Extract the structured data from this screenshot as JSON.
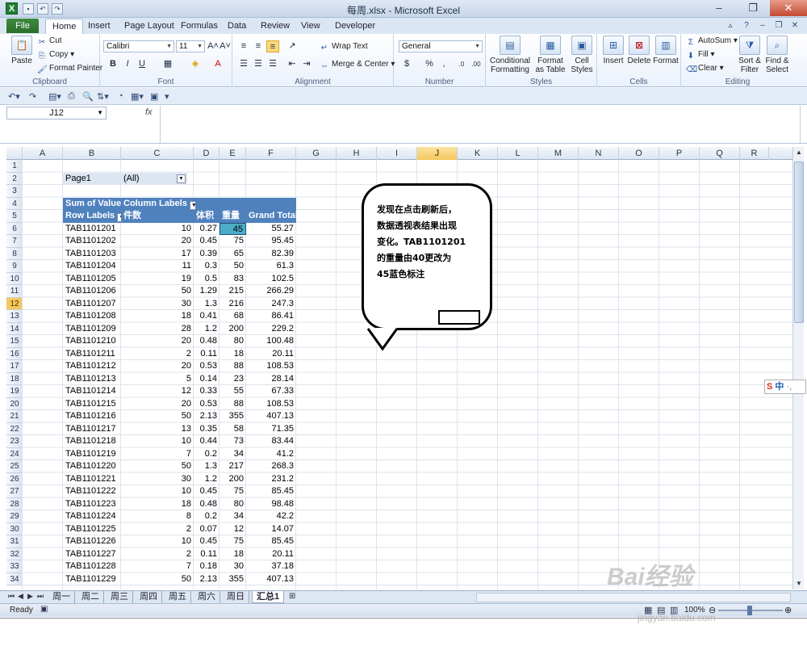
{
  "window": {
    "title": "每周.xlsx - Microsoft Excel",
    "logo_letter": "X"
  },
  "tabs": {
    "file": "File",
    "items": [
      "Home",
      "Insert",
      "Page Layout",
      "Formulas",
      "Data",
      "Review",
      "View",
      "Developer"
    ],
    "active": "Home"
  },
  "ribbon": {
    "clipboard": {
      "paste": "Paste",
      "cut": "Cut",
      "copy": "Copy",
      "format_painter": "Format Painter",
      "label": "Clipboard"
    },
    "font": {
      "name": "Calibri",
      "size": "11",
      "bold": "B",
      "italic": "I",
      "underline": "U",
      "label": "Font"
    },
    "alignment": {
      "wrap_text": "Wrap Text",
      "merge_center": "Merge & Center",
      "label": "Alignment"
    },
    "number": {
      "format": "General",
      "currency": "$",
      "percent": "%",
      "comma": ",",
      "label": "Number"
    },
    "styles": {
      "conditional": "Conditional Formatting",
      "format_table": "Format as Table",
      "cell_styles": "Cell Styles",
      "label": "Styles"
    },
    "cells": {
      "insert": "Insert",
      "delete": "Delete",
      "format": "Format",
      "label": "Cells"
    },
    "editing": {
      "autosum": "AutoSum",
      "fill": "Fill",
      "clear": "Clear",
      "sort_filter": "Sort & Filter",
      "find_select": "Find & Select",
      "label": "Editing"
    }
  },
  "formula_bar": {
    "name_box": "J12",
    "fx": "fx",
    "value": ""
  },
  "grid": {
    "columns": [
      "A",
      "B",
      "C",
      "D",
      "E",
      "F",
      "G",
      "H",
      "I",
      "J",
      "K",
      "L",
      "M",
      "N",
      "O",
      "P",
      "Q",
      "R"
    ],
    "selected_column": "J",
    "rows": [
      "1",
      "2",
      "3",
      "4",
      "5",
      "6",
      "7",
      "8",
      "9",
      "10",
      "11",
      "12",
      "13",
      "14",
      "15",
      "16",
      "17",
      "18",
      "19",
      "20",
      "21",
      "22",
      "23",
      "24",
      "25",
      "26",
      "27",
      "28",
      "29",
      "30",
      "31",
      "32",
      "33",
      "34"
    ],
    "selected_row": "12"
  },
  "pivot": {
    "page_field": "Page1",
    "page_value": "(All)",
    "sum_of_value": "Sum of Value",
    "column_labels": "Column Labels",
    "row_labels": "Row Labels",
    "col_headers": [
      "件数",
      "体积",
      "重量",
      "Grand Total"
    ],
    "rows": [
      {
        "label": "TAB1101201",
        "count": "10",
        "volume": "0.27",
        "weight": "45",
        "total": "55.27"
      },
      {
        "label": "TAB1101202",
        "count": "20",
        "volume": "0.45",
        "weight": "75",
        "total": "95.45"
      },
      {
        "label": "TAB1101203",
        "count": "17",
        "volume": "0.39",
        "weight": "65",
        "total": "82.39"
      },
      {
        "label": "TAB1101204",
        "count": "11",
        "volume": "0.3",
        "weight": "50",
        "total": "61.3"
      },
      {
        "label": "TAB1101205",
        "count": "19",
        "volume": "0.5",
        "weight": "83",
        "total": "102.5"
      },
      {
        "label": "TAB1101206",
        "count": "50",
        "volume": "1.29",
        "weight": "215",
        "total": "266.29"
      },
      {
        "label": "TAB1101207",
        "count": "30",
        "volume": "1.3",
        "weight": "216",
        "total": "247.3"
      },
      {
        "label": "TAB1101208",
        "count": "18",
        "volume": "0.41",
        "weight": "68",
        "total": "86.41"
      },
      {
        "label": "TAB1101209",
        "count": "28",
        "volume": "1.2",
        "weight": "200",
        "total": "229.2"
      },
      {
        "label": "TAB1101210",
        "count": "20",
        "volume": "0.48",
        "weight": "80",
        "total": "100.48"
      },
      {
        "label": "TAB1101211",
        "count": "2",
        "volume": "0.11",
        "weight": "18",
        "total": "20.11"
      },
      {
        "label": "TAB1101212",
        "count": "20",
        "volume": "0.53",
        "weight": "88",
        "total": "108.53"
      },
      {
        "label": "TAB1101213",
        "count": "5",
        "volume": "0.14",
        "weight": "23",
        "total": "28.14"
      },
      {
        "label": "TAB1101214",
        "count": "12",
        "volume": "0.33",
        "weight": "55",
        "total": "67.33"
      },
      {
        "label": "TAB1101215",
        "count": "20",
        "volume": "0.53",
        "weight": "88",
        "total": "108.53"
      },
      {
        "label": "TAB1101216",
        "count": "50",
        "volume": "2.13",
        "weight": "355",
        "total": "407.13"
      },
      {
        "label": "TAB1101217",
        "count": "13",
        "volume": "0.35",
        "weight": "58",
        "total": "71.35"
      },
      {
        "label": "TAB1101218",
        "count": "10",
        "volume": "0.44",
        "weight": "73",
        "total": "83.44"
      },
      {
        "label": "TAB1101219",
        "count": "7",
        "volume": "0.2",
        "weight": "34",
        "total": "41.2"
      },
      {
        "label": "TAB1101220",
        "count": "50",
        "volume": "1.3",
        "weight": "217",
        "total": "268.3"
      },
      {
        "label": "TAB1101221",
        "count": "30",
        "volume": "1.2",
        "weight": "200",
        "total": "231.2"
      },
      {
        "label": "TAB1101222",
        "count": "10",
        "volume": "0.45",
        "weight": "75",
        "total": "85.45"
      },
      {
        "label": "TAB1101223",
        "count": "18",
        "volume": "0.48",
        "weight": "80",
        "total": "98.48"
      },
      {
        "label": "TAB1101224",
        "count": "8",
        "volume": "0.2",
        "weight": "34",
        "total": "42.2"
      },
      {
        "label": "TAB1101225",
        "count": "2",
        "volume": "0.07",
        "weight": "12",
        "total": "14.07"
      },
      {
        "label": "TAB1101226",
        "count": "10",
        "volume": "0.45",
        "weight": "75",
        "total": "85.45"
      },
      {
        "label": "TAB1101227",
        "count": "2",
        "volume": "0.11",
        "weight": "18",
        "total": "20.11"
      },
      {
        "label": "TAB1101228",
        "count": "7",
        "volume": "0.18",
        "weight": "30",
        "total": "37.18"
      },
      {
        "label": "TAB1101229",
        "count": "50",
        "volume": "2.13",
        "weight": "355",
        "total": "407.13"
      }
    ]
  },
  "callout": {
    "lines": [
      "发现在点击刷新后，",
      "数据透视表结果出现",
      "变化。TAB1101201",
      "的重量由40更改为",
      "45蓝色标注"
    ]
  },
  "sheet_tabs": {
    "items": [
      "周一",
      "周二",
      "周三",
      "周四",
      "周五",
      "周六",
      "周日",
      "汇总1"
    ],
    "active": "汇总1"
  },
  "status": {
    "text": "Ready",
    "zoom": "100%"
  },
  "ime": {
    "label": "中"
  },
  "watermark": {
    "text": "Bai经验",
    "url": "jingyan.baidu.com"
  },
  "colors": {
    "pivot_header": "#4f81bd",
    "selected_cell": "#4bacc6",
    "file_tab": "#2a6f2b"
  }
}
